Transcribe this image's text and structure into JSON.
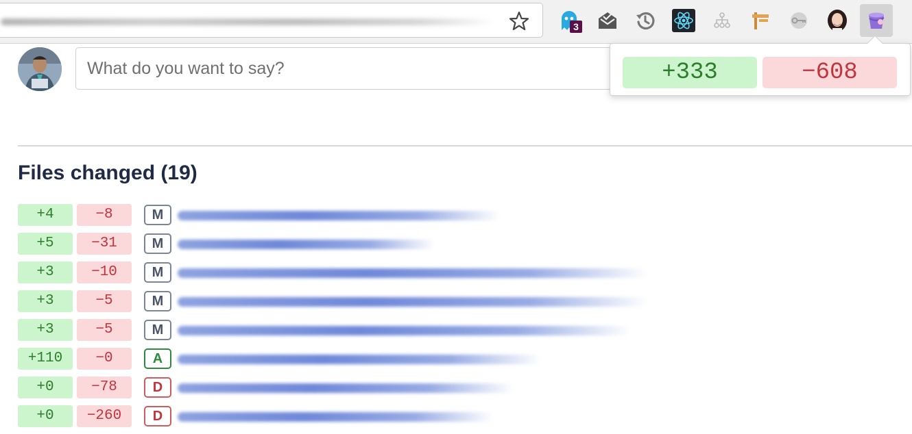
{
  "browser": {
    "extensions": [
      {
        "name": "ghostery",
        "badge": "3"
      },
      {
        "name": "mail-icon"
      },
      {
        "name": "history-icon"
      },
      {
        "name": "react-icon"
      },
      {
        "name": "sitemap-icon"
      },
      {
        "name": "signpost-icon"
      },
      {
        "name": "key-icon"
      },
      {
        "name": "profile-avatar"
      },
      {
        "name": "bucket-icon",
        "active": true
      }
    ]
  },
  "composer": {
    "placeholder": "What do you want to say?"
  },
  "popup": {
    "additions": "+333",
    "deletions": "−608"
  },
  "files": {
    "heading": "Files changed (19)",
    "rows": [
      {
        "add": "+4",
        "del": "−8",
        "status": "M"
      },
      {
        "add": "+5",
        "del": "−31",
        "status": "M"
      },
      {
        "add": "+3",
        "del": "−10",
        "status": "M"
      },
      {
        "add": "+3",
        "del": "−5",
        "status": "M"
      },
      {
        "add": "+3",
        "del": "−5",
        "status": "M"
      },
      {
        "add": "+110",
        "del": "−0",
        "status": "A"
      },
      {
        "add": "+0",
        "del": "−78",
        "status": "D"
      },
      {
        "add": "+0",
        "del": "−260",
        "status": "D"
      }
    ]
  },
  "colors": {
    "add_bg": "#cdf5cd",
    "add_text": "#2d7d2d",
    "del_bg": "#fbd9db",
    "del_text": "#c0353d",
    "heading": "#1f2a44"
  }
}
